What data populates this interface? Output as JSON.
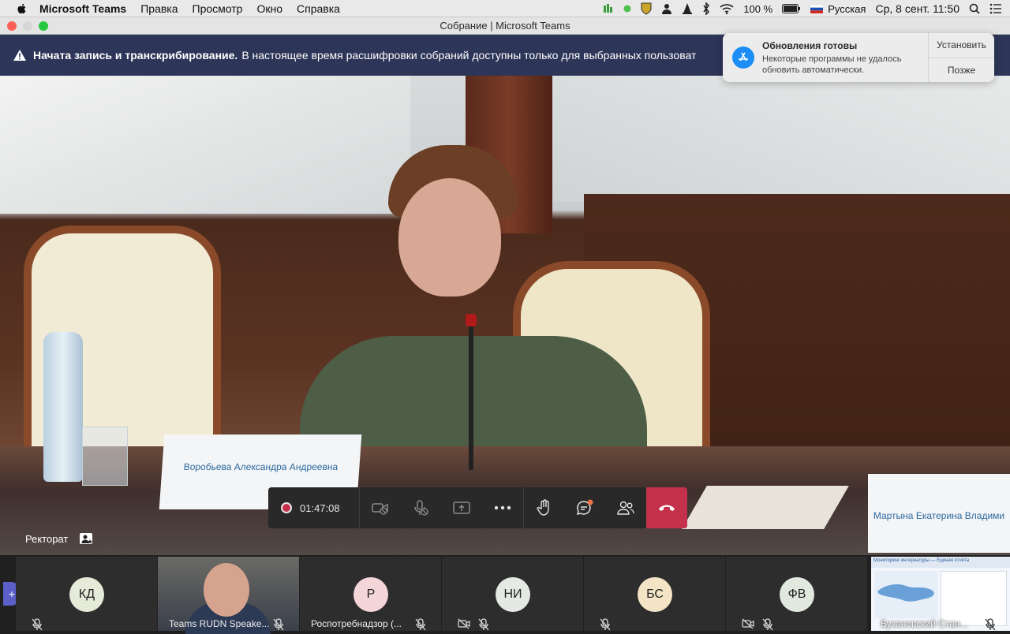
{
  "menubar": {
    "app_name": "Microsoft Teams",
    "menus": [
      "Правка",
      "Просмотр",
      "Окно",
      "Справка"
    ],
    "battery": "100 %",
    "language": "Русская",
    "datetime": "Ср, 8 сент.  11:50"
  },
  "window": {
    "title": "Собрание | Microsoft Teams"
  },
  "banner": {
    "title": "Начата запись и транскрибирование.",
    "text": "В настоящее время расшифровки собраний доступны только для выбранных пользоват"
  },
  "stage": {
    "nameplate_main": "Воробьева Александра Андреевна",
    "nameplate_right": "Мартына Екатерина Владими",
    "label": "Ректорат"
  },
  "controls": {
    "timer": "01:47:08"
  },
  "participants": [
    {
      "initials": "КД",
      "color": "#e6ead9"
    },
    {
      "name": "Teams RUDN Speake..."
    },
    {
      "initials": "Р",
      "name": "Роспотребнадзор (...",
      "color": "#f4d5d8"
    },
    {
      "initials": "НИ",
      "color": "#e4e9e4"
    },
    {
      "initials": "БС",
      "color": "#f4e4c6"
    },
    {
      "initials": "ФВ",
      "color": "#e1e8de"
    },
    {
      "name": "Бузановский Стан..."
    }
  ],
  "screen_share": {
    "header": "Мониторинг интернатуры — Единая отчёта"
  },
  "notification": {
    "title": "Обновления готовы",
    "body": "Некоторые программы не удалось обновить автоматически.",
    "install": "Установить",
    "later": "Позже"
  },
  "colors": {
    "teams_purple": "#5b5fc7",
    "hangup_red": "#c4314b",
    "banner_bg": "#2d3558"
  }
}
